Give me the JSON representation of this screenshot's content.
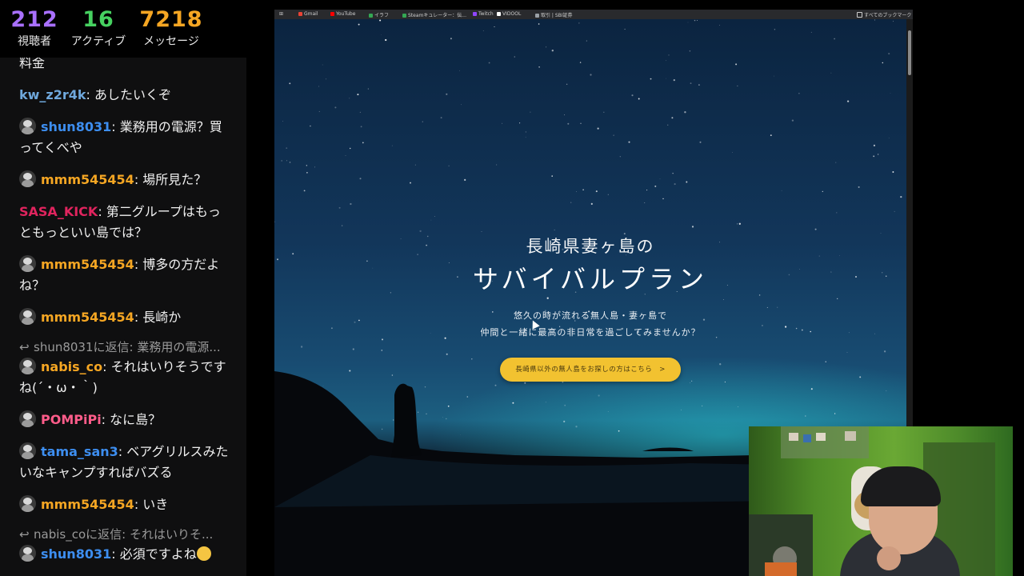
{
  "stats": {
    "viewers": {
      "value": "212",
      "label": "視聴者",
      "color": "#a970ff"
    },
    "active": {
      "value": "16",
      "label": "アクティブ",
      "color": "#46d160"
    },
    "messages": {
      "value": "7218",
      "label": "メッセージ",
      "color": "#f5a623"
    }
  },
  "chat": {
    "messages": [
      {
        "type": "msg",
        "avatar": false,
        "user": "",
        "user_color": "#ffffff",
        "text": "料金"
      },
      {
        "type": "msg",
        "avatar": false,
        "user": "kw_z2r4k",
        "user_color": "#6fa8dc",
        "text": "あしたいくぞ"
      },
      {
        "type": "msg",
        "avatar": true,
        "user": "shun8031",
        "user_color": "#3d8ef0",
        "text": "業務用の電源？買ってくべや"
      },
      {
        "type": "msg",
        "avatar": true,
        "user": "mmm545454",
        "user_color": "#f5a623",
        "text": "場所見た？"
      },
      {
        "type": "msg",
        "avatar": false,
        "user": "SASA_KICK",
        "user_color": "#e0245e",
        "text": "第二グループはもっともっといい島では？"
      },
      {
        "type": "msg",
        "avatar": true,
        "user": "mmm545454",
        "user_color": "#f5a623",
        "text": "博多の方だよね？"
      },
      {
        "type": "msg",
        "avatar": true,
        "user": "mmm545454",
        "user_color": "#f5a623",
        "text": "長崎か"
      },
      {
        "type": "reply",
        "text": "shun8031に返信: 業務用の電源..."
      },
      {
        "type": "msg",
        "avatar": true,
        "user": "nabis_co",
        "user_color": "#f5a623",
        "text": "それはいりそうですね(´・ω・｀)"
      },
      {
        "type": "msg",
        "avatar": true,
        "user": "POMPiPi",
        "user_color": "#ff5c8a",
        "text": "なに島？"
      },
      {
        "type": "msg",
        "avatar": true,
        "user": "tama_san3",
        "user_color": "#3d8ef0",
        "text": "ベアグリルスみたいなキャンプすればバズる"
      },
      {
        "type": "msg",
        "avatar": true,
        "user": "mmm545454",
        "user_color": "#f5a623",
        "text": "いき"
      },
      {
        "type": "reply",
        "text": "nabis_coに返信: それはいりそ..."
      },
      {
        "type": "msg",
        "avatar": true,
        "user": "shun8031",
        "user_color": "#3d8ef0",
        "text": "必須ですよね",
        "emoji": "thinking-face"
      }
    ]
  },
  "browser": {
    "bookmarks": [
      {
        "label": "Gmail",
        "icon": "gmail-icon",
        "color": "#ea4335"
      },
      {
        "label": "YouTube",
        "icon": "youtube-icon",
        "color": "#ff0000"
      },
      {
        "label": "イラフ",
        "icon": "check-icon",
        "color": "#34a853"
      },
      {
        "label": "Steamキュレーター：伝...",
        "icon": "check-icon",
        "color": "#34a853"
      },
      {
        "label": "Twitch",
        "icon": "twitch-icon",
        "color": "#9146ff"
      },
      {
        "label": "VIDOOL",
        "icon": "check-icon",
        "color": "#ffffff"
      },
      {
        "label": "取引 | SBI証券",
        "icon": "bookmark-icon",
        "color": "#9aa0a6"
      }
    ],
    "all_bookmarks": "すべてのブックマーク",
    "hero": {
      "subtitle": "長崎県妻ヶ島の",
      "title": "サバイバルプラン",
      "desc_line1": "悠久の時が流れる無人島・妻ヶ島で",
      "desc_line2": "仲間と一緒に最高の非日常を過ごしてみませんか？",
      "cta": "長崎県以外の無人島をお探しの方はこちら　>"
    }
  }
}
